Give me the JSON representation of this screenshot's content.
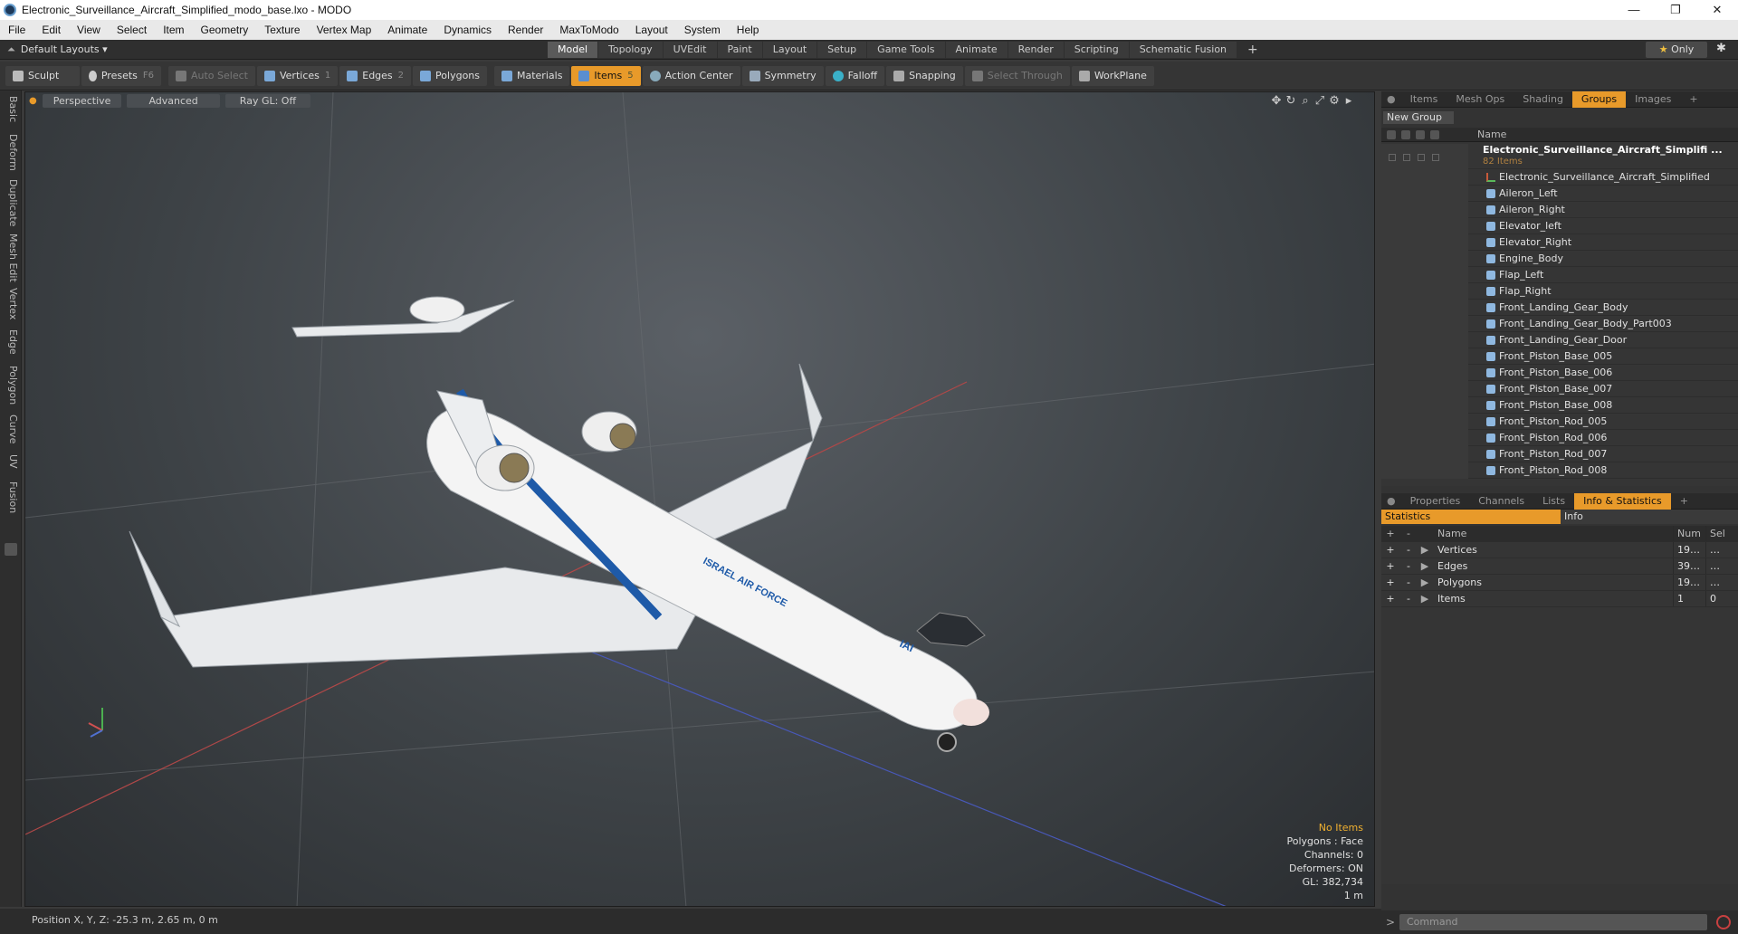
{
  "window": {
    "title": "Electronic_Surveillance_Aircraft_Simplified_modo_base.lxo - MODO",
    "min": "—",
    "max": "❐",
    "close": "✕"
  },
  "menu": [
    "File",
    "Edit",
    "View",
    "Select",
    "Item",
    "Geometry",
    "Texture",
    "Vertex Map",
    "Animate",
    "Dynamics",
    "Render",
    "MaxToModo",
    "Layout",
    "System",
    "Help"
  ],
  "layout": {
    "name": "Default Layouts ▾",
    "tabs": [
      "Model",
      "Topology",
      "UVEdit",
      "Paint",
      "Layout",
      "Setup",
      "Game Tools",
      "Animate",
      "Render",
      "Scripting",
      "Schematic Fusion",
      "+"
    ],
    "active_tab": "Model",
    "only_label": "Only",
    "only_icon": "★",
    "settings_icon": "✱"
  },
  "toolbar": {
    "sculpt": "Sculpt",
    "presets": "Presets",
    "presets_key": "F6",
    "auto_select": "Auto Select",
    "vertices": "Vertices",
    "vertices_key": "1",
    "edges": "Edges",
    "edges_key": "2",
    "polygons": "Polygons",
    "materials": "Materials",
    "items": "Items",
    "items_key": "5",
    "action_center": "Action Center",
    "symmetry": "Symmetry",
    "falloff": "Falloff",
    "snapping": "Snapping",
    "select_through": "Select Through",
    "workplane": "WorkPlane"
  },
  "left_tabs": [
    "Basic",
    "Deform",
    "Duplicate",
    "Mesh Edit",
    "Vertex",
    "Edge",
    "Polygon",
    "Curve",
    "UV",
    "Fusion"
  ],
  "viewport": {
    "view_mode": "Perspective",
    "shading": "Advanced",
    "raygl": "Ray GL: Off",
    "hud": {
      "no_items": "No Items",
      "polygons": "Polygons : Face",
      "channels": "Channels: 0",
      "deformers": "Deformers: ON",
      "gl": "GL: 382,734",
      "scale": "1 m"
    },
    "livery": {
      "text1": "ISRAEL AIR FORCE",
      "text2": "IAI"
    }
  },
  "status": {
    "position": "Position X, Y, Z:   -25.3 m, 2.65 m, 0 m"
  },
  "panel_top": {
    "tabs": [
      "Items",
      "Mesh Ops",
      "Shading",
      "Groups",
      "Images",
      "+"
    ],
    "active": "Groups",
    "new_group": "New Group",
    "name_col": "Name",
    "group": {
      "name": "Electronic_Surveillance_Aircraft_Simplifi ...",
      "count": "82 Items"
    },
    "items": [
      "Electronic_Surveillance_Aircraft_Simplified",
      "Aileron_Left",
      "Aileron_Right",
      "Elevator_left",
      "Elevator_Right",
      "Engine_Body",
      "Flap_Left",
      "Flap_Right",
      "Front_Landing_Gear_Body",
      "Front_Landing_Gear_Body_Part003",
      "Front_Landing_Gear_Door",
      "Front_Piston_Base_005",
      "Front_Piston_Base_006",
      "Front_Piston_Base_007",
      "Front_Piston_Base_008",
      "Front_Piston_Rod_005",
      "Front_Piston_Rod_006",
      "Front_Piston_Rod_007",
      "Front_Piston_Rod_008"
    ]
  },
  "panel_bottom": {
    "tabs": [
      "Properties",
      "Channels",
      "Lists",
      "Info & Statistics",
      "+"
    ],
    "active": "Info & Statistics",
    "statistics": "Statistics",
    "info": "Info",
    "cols": {
      "name": "Name",
      "num": "Num",
      "sel": "Sel"
    },
    "rows": [
      {
        "name": "Vertices",
        "num": "19…",
        "sel": "…"
      },
      {
        "name": "Edges",
        "num": "39…",
        "sel": "…"
      },
      {
        "name": "Polygons",
        "num": "19…",
        "sel": "…"
      },
      {
        "name": "Items",
        "num": "1",
        "sel": "0"
      }
    ]
  },
  "command": {
    "placeholder": "Command",
    "prompt": ">"
  },
  "colors": {
    "accent": "#e89a2a",
    "livery_blue": "#1e5aa8",
    "fuselage": "#f4f4f4"
  }
}
